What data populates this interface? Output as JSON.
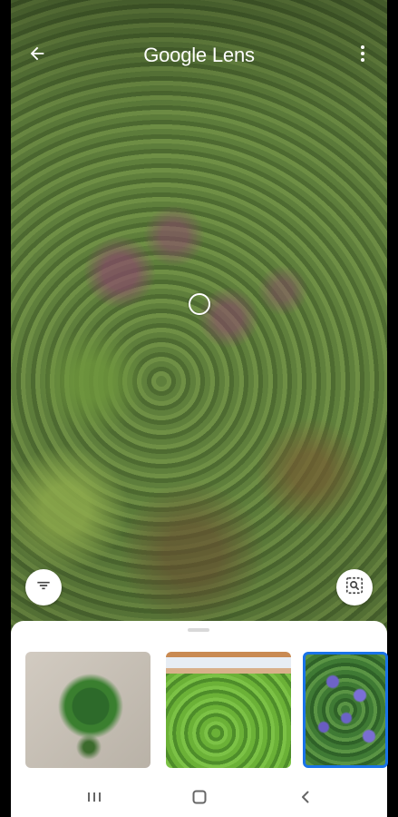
{
  "header": {
    "title": "Google Lens",
    "back_icon": "arrow-back-icon",
    "menu_icon": "more-vert-icon"
  },
  "viewfinder": {
    "focus_icon": "focus-circle-icon",
    "filter_icon": "filter-icon",
    "search_icon": "image-search-icon"
  },
  "results": {
    "selected_index": 2,
    "thumbnails": [
      {
        "name": "plant-thumbnail-1"
      },
      {
        "name": "plant-thumbnail-2"
      },
      {
        "name": "plant-thumbnail-3"
      }
    ],
    "accent_color": "#1a73e8"
  },
  "system_nav": {
    "recent_icon": "recent-apps-icon",
    "home_icon": "home-icon",
    "back_icon": "nav-back-icon"
  }
}
